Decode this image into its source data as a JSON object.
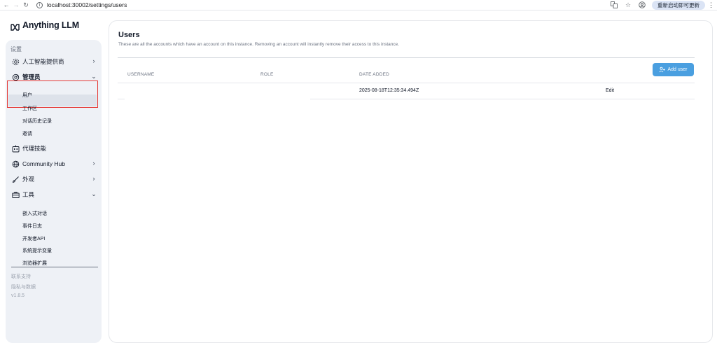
{
  "browser": {
    "url": "localhost:30002/settings/users",
    "update_label": "重新启动即可更新"
  },
  "brand": {
    "name": "Anything LLM"
  },
  "sidebar": {
    "section_label": "设置",
    "items": [
      {
        "label": "人工智能提供商",
        "icon": "gear-icon"
      },
      {
        "label": "管理员",
        "icon": "admin-icon"
      },
      {
        "label": "代理技能",
        "icon": "robot-icon"
      },
      {
        "label": "Community Hub",
        "icon": "globe-icon"
      },
      {
        "label": "外观",
        "icon": "brush-icon"
      },
      {
        "label": "工具",
        "icon": "toolbox-icon"
      }
    ],
    "admin_subitems": [
      "用户",
      "工作区",
      "对话历史记录",
      "邀请"
    ],
    "tool_subitems": [
      "嵌入式对话",
      "事件日志",
      "开发者API",
      "系统提示变量",
      "浏览器扩展"
    ],
    "footer": {
      "contact": "联系支持",
      "privacy": "隐私与数据",
      "version": "v1.8.5"
    }
  },
  "main": {
    "title": "Users",
    "description": "These are all the accounts which have an account on this instance. Removing an account will instantly remove their access to this instance.",
    "add_user_label": "Add user",
    "table": {
      "headers": [
        "USERNAME",
        "ROLE",
        "DATE ADDED"
      ],
      "rows": [
        {
          "username": "",
          "role": "",
          "date_added": "2025-08-18T12:35:34.494Z",
          "action": "Edit"
        }
      ]
    }
  },
  "colors": {
    "accent": "#4a9fe0",
    "highlight": "#e53935",
    "sidebar_bg": "#eef1f6"
  }
}
